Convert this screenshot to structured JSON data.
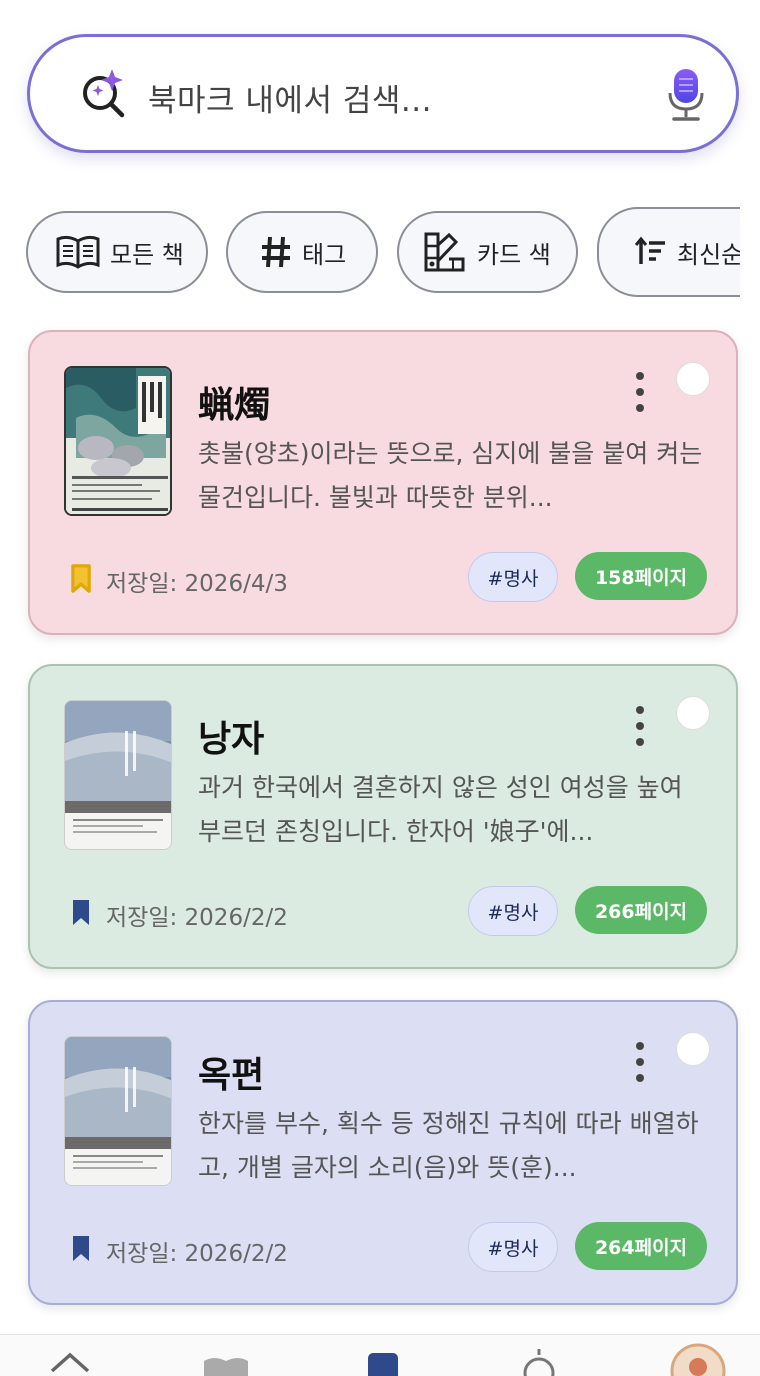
{
  "search": {
    "placeholder": "북마크 내에서 검색..."
  },
  "filters": [
    {
      "label": "모든 책",
      "icon": "book-open-icon"
    },
    {
      "label": "태그",
      "icon": "hash-icon"
    },
    {
      "label": "카드 색",
      "icon": "color-palette-icon"
    },
    {
      "label": "최신순",
      "icon": "sort-icon"
    }
  ],
  "cards": [
    {
      "title": "蝋燭",
      "description": "촛불(양초)이라는 뜻으로, 심지에 불을 붙여 켜는 물건입니다. 불빛과 따뜻한 분위...",
      "saved": "저장일: 2026/4/3",
      "tag": "#명사",
      "pages": "158페이지",
      "bookmark_color": "#f2c230",
      "card_color": "#f8dbe1"
    },
    {
      "title": "낭자",
      "description": "과거 한국에서 결혼하지 않은 성인 여성을 높여 부르던 존칭입니다. 한자어 '娘子'에...",
      "saved": "저장일: 2026/2/2",
      "tag": "#명사",
      "pages": "266페이지",
      "bookmark_color": "#2f4a8a",
      "card_color": "#dcebe1"
    },
    {
      "title": "옥편",
      "description": "한자를 부수, 획수 등 정해진 규칙에 따라 배열하고, 개별 글자의 소리(음)와 뜻(훈)...",
      "saved": "저장일: 2026/2/2",
      "tag": "#명사",
      "pages": "264페이지",
      "bookmark_color": "#2f4a8a",
      "card_color": "#dcdff4"
    }
  ],
  "colors": {
    "accent": "#7a6fd6",
    "page_badge": "#5bb866",
    "tag_bg": "#e2e6fb"
  }
}
